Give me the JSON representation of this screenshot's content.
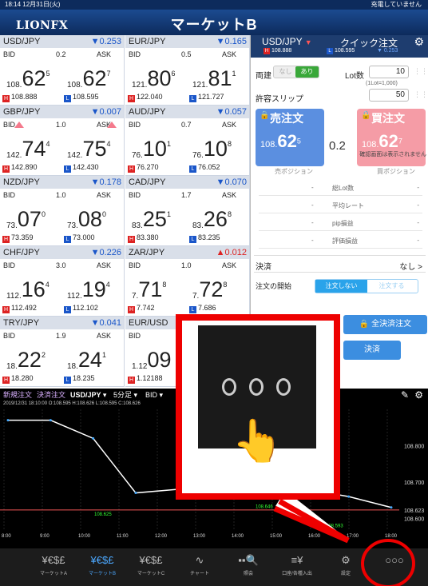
{
  "status": {
    "time": "18:14  12月31日(火)",
    "right": "充電していません"
  },
  "header": {
    "logo": "LIONFX",
    "title": "マーケットB"
  },
  "tiles": [
    {
      "pair": "USD/JPY",
      "chg": "▼0.253",
      "dir": "down",
      "bidl": "BID",
      "spr": "0.2",
      "askl": "ASK",
      "bid_pre": "108.",
      "bid_big": "62",
      "bid_pip": "5",
      "ask_pre": "108.",
      "ask_big": "62",
      "ask_pip": "7",
      "high": "108.888",
      "low": "108.595",
      "arrows": false
    },
    {
      "pair": "EUR/JPY",
      "chg": "▼0.165",
      "dir": "down",
      "bidl": "BID",
      "spr": "0.5",
      "askl": "ASK",
      "bid_pre": "121.",
      "bid_big": "80",
      "bid_pip": "6",
      "ask_pre": "121.",
      "ask_big": "81",
      "ask_pip": "1",
      "high": "122.040",
      "low": "121.727",
      "arrows": false
    },
    {
      "pair": "GBP/JPY",
      "chg": "▼0.007",
      "dir": "down",
      "bidl": "BID",
      "spr": "1.0",
      "askl": "ASK",
      "bid_pre": "142.",
      "bid_big": "74",
      "bid_pip": "4",
      "ask_pre": "142.",
      "ask_big": "75",
      "ask_pip": "4",
      "high": "142.890",
      "low": "142.430",
      "arrows": true
    },
    {
      "pair": "AUD/JPY",
      "chg": "▼0.057",
      "dir": "down",
      "bidl": "BID",
      "spr": "0.7",
      "askl": "ASK",
      "bid_pre": "76.",
      "bid_big": "10",
      "bid_pip": "1",
      "ask_pre": "76.",
      "ask_big": "10",
      "ask_pip": "8",
      "high": "76.270",
      "low": "76.052",
      "arrows": false
    },
    {
      "pair": "NZD/JPY",
      "chg": "▼0.178",
      "dir": "down",
      "bidl": "BID",
      "spr": "1.0",
      "askl": "ASK",
      "bid_pre": "73.",
      "bid_big": "07",
      "bid_pip": "0",
      "ask_pre": "73.",
      "ask_big": "08",
      "ask_pip": "0",
      "high": "73.359",
      "low": "73.000",
      "arrows": false
    },
    {
      "pair": "CAD/JPY",
      "chg": "▼0.070",
      "dir": "down",
      "bidl": "BID",
      "spr": "1.7",
      "askl": "ASK",
      "bid_pre": "83.",
      "bid_big": "25",
      "bid_pip": "1",
      "ask_pre": "83.",
      "ask_big": "26",
      "ask_pip": "8",
      "high": "83.380",
      "low": "83.235",
      "arrows": false
    },
    {
      "pair": "CHF/JPY",
      "chg": "▼0.226",
      "dir": "down",
      "bidl": "BID",
      "spr": "3.0",
      "askl": "ASK",
      "bid_pre": "112.",
      "bid_big": "16",
      "bid_pip": "4",
      "ask_pre": "112.",
      "ask_big": "19",
      "ask_pip": "4",
      "high": "112.492",
      "low": "112.102",
      "arrows": false
    },
    {
      "pair": "ZAR/JPY",
      "chg": "▲0.012",
      "dir": "up",
      "bidl": "BID",
      "spr": "1.0",
      "askl": "ASK",
      "bid_pre": "7.",
      "bid_big": "71",
      "bid_pip": "8",
      "ask_pre": "7.",
      "ask_big": "72",
      "ask_pip": "8",
      "high": "7.742",
      "low": "7.686",
      "arrows": false
    },
    {
      "pair": "TRY/JPY",
      "chg": "▼0.041",
      "dir": "down",
      "bidl": "BID",
      "spr": "1.9",
      "askl": "ASK",
      "bid_pre": "18.",
      "bid_big": "22",
      "bid_pip": "2",
      "ask_pre": "18.",
      "ask_big": "24",
      "ask_pip": "1",
      "high": "18.280",
      "low": "18.235",
      "arrows": false
    },
    {
      "pair": "EUR/USD",
      "chg": "",
      "dir": "down",
      "bidl": "BID",
      "spr": "",
      "askl": "",
      "bid_pre": "1.12",
      "bid_big": "09",
      "bid_pip": "",
      "ask_pre": "",
      "ask_big": "",
      "ask_pip": "",
      "high": "1.12188",
      "low": "",
      "arrows": false
    }
  ],
  "panel": {
    "pair": "USD/JPY",
    "quick_order": "クイック注文",
    "high": "108.888",
    "low": "108.595",
    "change": "▼ 0.253",
    "ryodate": "両建",
    "toggle_off": "なし",
    "toggle_on": "あり",
    "lot_label": "Lot数",
    "lot_value": "10",
    "lot_hint": "(1Lot=1,000)",
    "slip_label": "許容スリップ",
    "slip_value": "50",
    "sell_label": "売注文",
    "sell_pre": "108.",
    "sell_big": "62",
    "sell_pip": "5",
    "spread": "0.2",
    "buy_label": "買注文",
    "buy_pre": "108.",
    "buy_big": "62",
    "buy_pip": "7",
    "note": "確認画面は表示されません",
    "sell_pos": "売ポジション",
    "buy_pos": "買ポジション",
    "pos_rows": [
      {
        "label": "総Lot数",
        "l": "-",
        "r": "-"
      },
      {
        "label": "平均レート",
        "l": "-",
        "r": "-"
      },
      {
        "label": "pip損益",
        "l": "-",
        "r": "-"
      },
      {
        "label": "評価損益",
        "l": "-",
        "r": "-"
      }
    ],
    "kessai": "決済",
    "kessai_val": "なし >",
    "start_label": "注文の開始",
    "seg_a": "注文しない",
    "seg_b": "注文する",
    "allclose": "全決済注文",
    "close2": "決済"
  },
  "chart_bar": {
    "order": "新規注文",
    "close": "決済注文",
    "pair": "USD/JPY ▾",
    "tf": "5分足 ▾",
    "bid": "BID ▾",
    "info": "2019/12/31 18:10:00  O:108.595  H:108.626  L:108.595  C:108.626"
  },
  "chart_data": {
    "type": "line",
    "x": [
      "9:00",
      "10:00",
      "11:00",
      "12:00",
      "13:00",
      "14:00",
      "15:00",
      "16:00",
      "17:00",
      "18:00"
    ],
    "series": [
      {
        "values": [
          108.87,
          108.87,
          108.82,
          108.67,
          108.68,
          108.7,
          108.69,
          108.68,
          108.66,
          108.63
        ]
      }
    ],
    "y_ticks": [
      "108.800",
      "108.700",
      "108.623",
      "108.600"
    ],
    "x_ticks": [
      "8:00",
      "9:00",
      "10:00",
      "11:00",
      "12:00",
      "13:00",
      "14:00",
      "15:00",
      "16:00",
      "17:00",
      "18:00"
    ],
    "labels": [
      "108.625",
      "108.646",
      "108.593"
    ],
    "ylim": [
      108.57,
      108.9
    ]
  },
  "nav": [
    {
      "icon": "¥€$£",
      "label": "マーケットA"
    },
    {
      "icon": "¥€$£",
      "label": "マーケットB"
    },
    {
      "icon": "¥€$£",
      "label": "マーケットC"
    },
    {
      "icon": "∿",
      "label": "チャート"
    },
    {
      "icon": "▪▪🔍",
      "label": "照会"
    },
    {
      "icon": "≡¥",
      "label": "口座/各種入出"
    },
    {
      "icon": "⚙",
      "label": "設定"
    },
    {
      "icon": "○○○",
      "label": ""
    }
  ],
  "colors": {
    "header": "#0d2b5c",
    "sell": "#5b8fe0",
    "buy": "#f59ca6",
    "highlight": "#e00000"
  }
}
